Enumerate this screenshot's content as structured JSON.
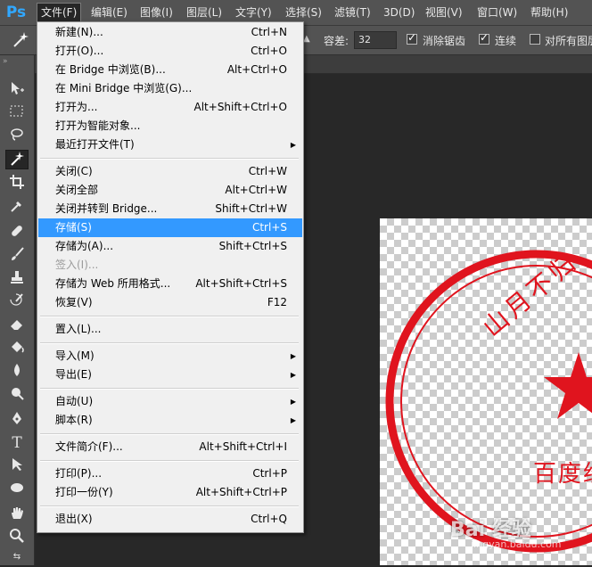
{
  "app": {
    "logo": "Ps",
    "accent": "#31a8ff"
  },
  "menubar": {
    "items": [
      {
        "label": "文件(F)"
      },
      {
        "label": "编辑(E)"
      },
      {
        "label": "图像(I)"
      },
      {
        "label": "图层(L)"
      },
      {
        "label": "文字(Y)"
      },
      {
        "label": "选择(S)"
      },
      {
        "label": "滤镜(T)"
      },
      {
        "label": "3D(D)"
      },
      {
        "label": "视图(V)"
      },
      {
        "label": "窗口(W)"
      },
      {
        "label": "帮助(H)"
      }
    ]
  },
  "options": {
    "tolerance_label": "容差:",
    "tolerance_value": "32",
    "antialias_label": "消除锯齿",
    "contiguous_label": "连续",
    "all_layers_label": "对所有图层"
  },
  "file_menu": {
    "items": [
      {
        "label": "新建(N)...",
        "shortcut": "Ctrl+N"
      },
      {
        "label": "打开(O)...",
        "shortcut": "Ctrl+O"
      },
      {
        "label": "在 Bridge 中浏览(B)...",
        "shortcut": "Alt+Ctrl+O"
      },
      {
        "label": "在 Mini Bridge 中浏览(G)...",
        "shortcut": ""
      },
      {
        "label": "打开为...",
        "shortcut": "Alt+Shift+Ctrl+O"
      },
      {
        "label": "打开为智能对象...",
        "shortcut": ""
      },
      {
        "label": "最近打开文件(T)",
        "shortcut": ""
      },
      {
        "label": "关闭(C)",
        "shortcut": "Ctrl+W"
      },
      {
        "label": "关闭全部",
        "shortcut": "Alt+Ctrl+W"
      },
      {
        "label": "关闭并转到 Bridge...",
        "shortcut": "Shift+Ctrl+W"
      },
      {
        "label": "存储(S)",
        "shortcut": "Ctrl+S"
      },
      {
        "label": "存储为(A)...",
        "shortcut": "Shift+Ctrl+S"
      },
      {
        "label": "签入(I)...",
        "shortcut": ""
      },
      {
        "label": "存储为 Web 所用格式...",
        "shortcut": "Alt+Shift+Ctrl+S"
      },
      {
        "label": "恢复(V)",
        "shortcut": "F12"
      },
      {
        "label": "置入(L)...",
        "shortcut": ""
      },
      {
        "label": "导入(M)",
        "shortcut": ""
      },
      {
        "label": "导出(E)",
        "shortcut": ""
      },
      {
        "label": "自动(U)",
        "shortcut": ""
      },
      {
        "label": "脚本(R)",
        "shortcut": ""
      },
      {
        "label": "文件简介(F)...",
        "shortcut": "Alt+Shift+Ctrl+I"
      },
      {
        "label": "打印(P)...",
        "shortcut": "Ctrl+P"
      },
      {
        "label": "打印一份(Y)",
        "shortcut": "Alt+Shift+Ctrl+P"
      },
      {
        "label": "退出(X)",
        "shortcut": "Ctrl+Q"
      }
    ]
  },
  "stamp": {
    "top_text": "山月不归",
    "bottom_text": "百度经",
    "color": "#e0141e"
  },
  "watermark": {
    "text": "Bai 经验",
    "sub": "jingyan.baidu.com"
  }
}
